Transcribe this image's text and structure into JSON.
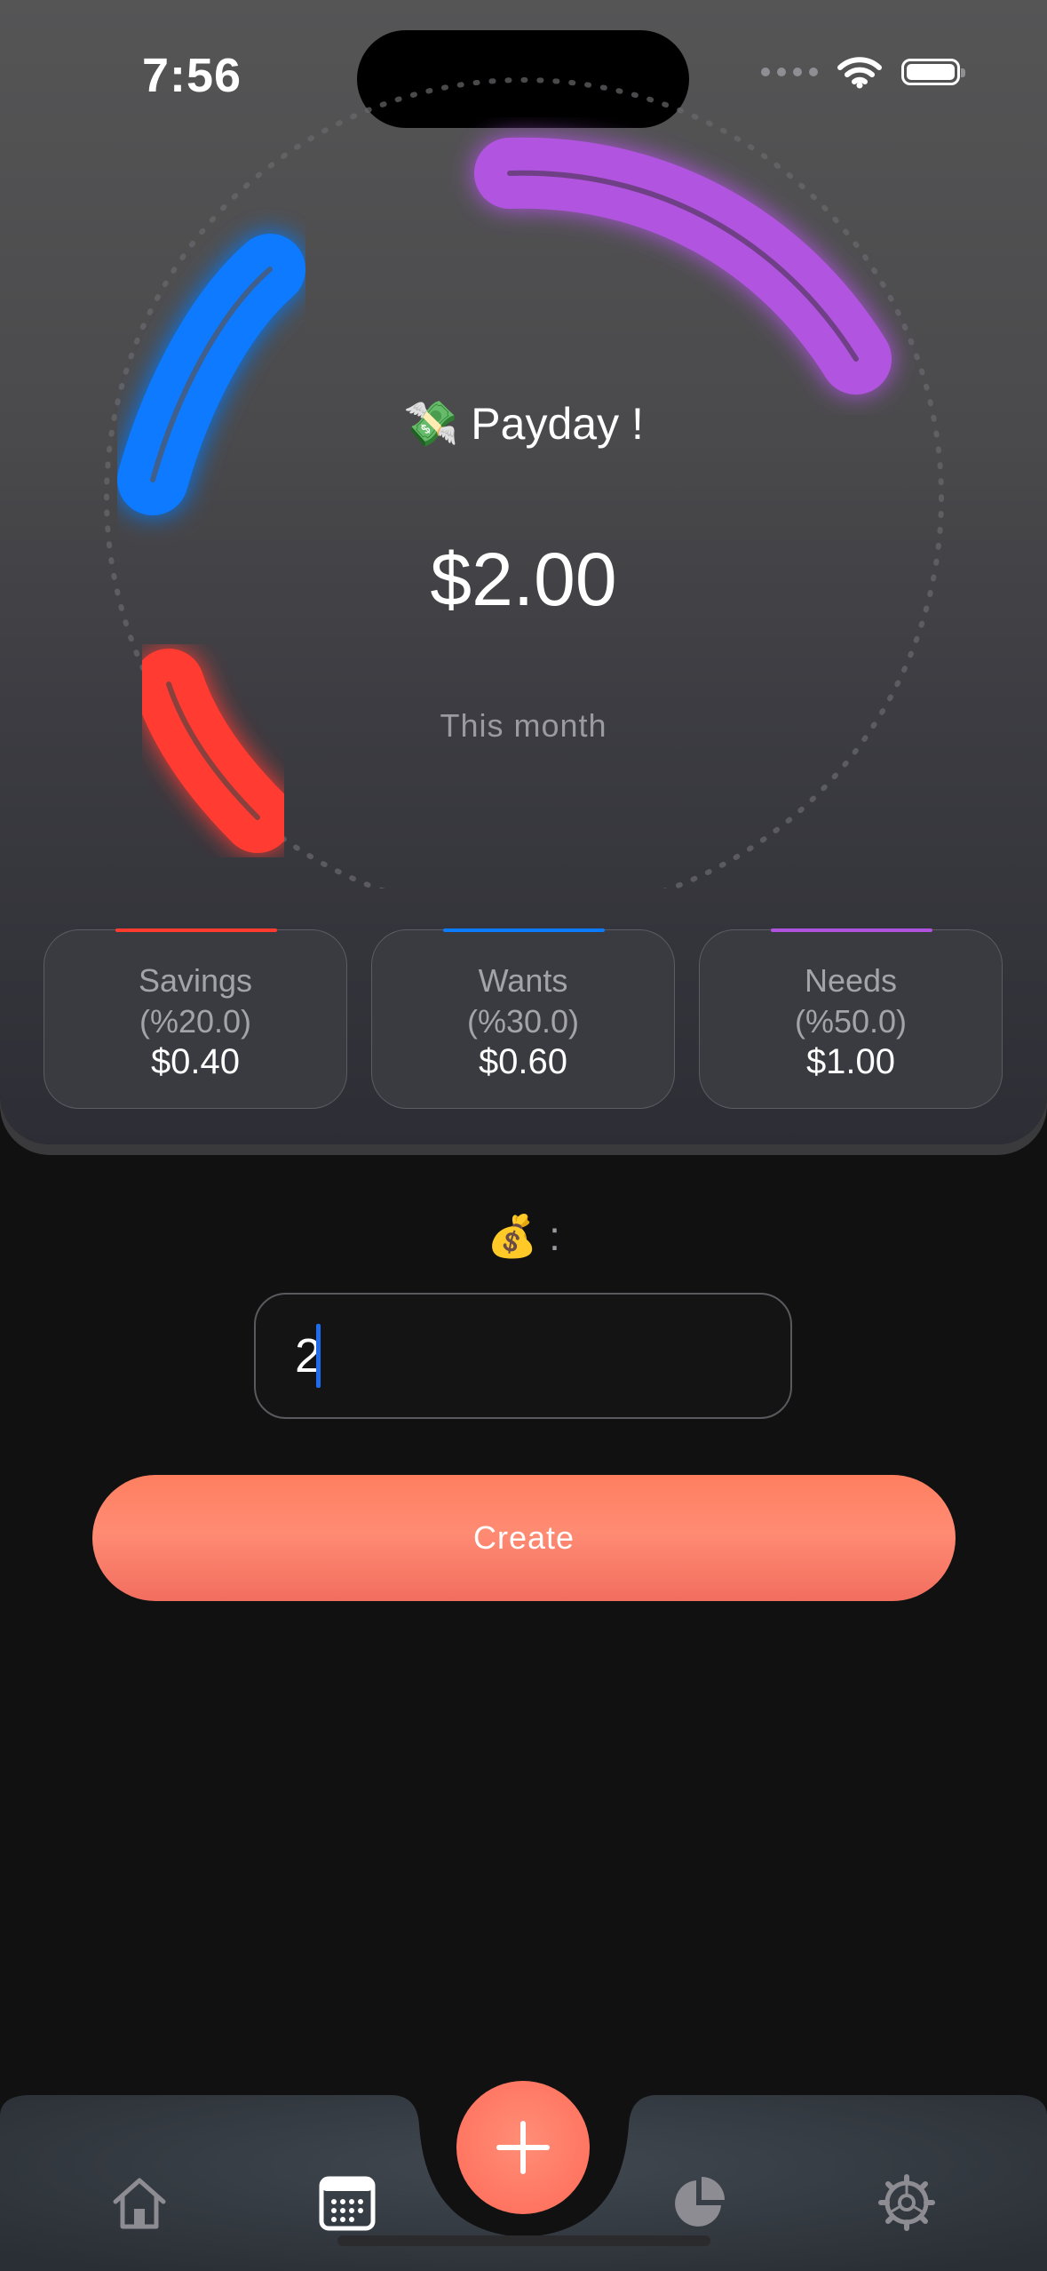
{
  "status_bar": {
    "time": "7:56"
  },
  "hero": {
    "title_emoji": "💸",
    "title": "Payday !",
    "amount": "$2.00",
    "period": "This month"
  },
  "categories": [
    {
      "name": "Savings",
      "percent": "(%20.0)",
      "value": "$0.40",
      "color": "#ff3b30"
    },
    {
      "name": "Wants",
      "percent": "(%30.0)",
      "value": "$0.60",
      "color": "#0a7aff"
    },
    {
      "name": "Needs",
      "percent": "(%50.0)",
      "value": "$1.00",
      "color": "#af52de"
    }
  ],
  "form": {
    "label_emoji": "💰",
    "label_suffix": ":",
    "amount_value": "2",
    "create_label": "Create"
  },
  "tabbar": {
    "tabs": [
      {
        "icon": "house-icon",
        "active": false
      },
      {
        "icon": "calendar-icon",
        "active": true
      },
      {
        "icon": "pie-chart-icon",
        "active": false
      },
      {
        "icon": "gear-icon",
        "active": false
      }
    ],
    "fab_icon": "plus-icon"
  }
}
